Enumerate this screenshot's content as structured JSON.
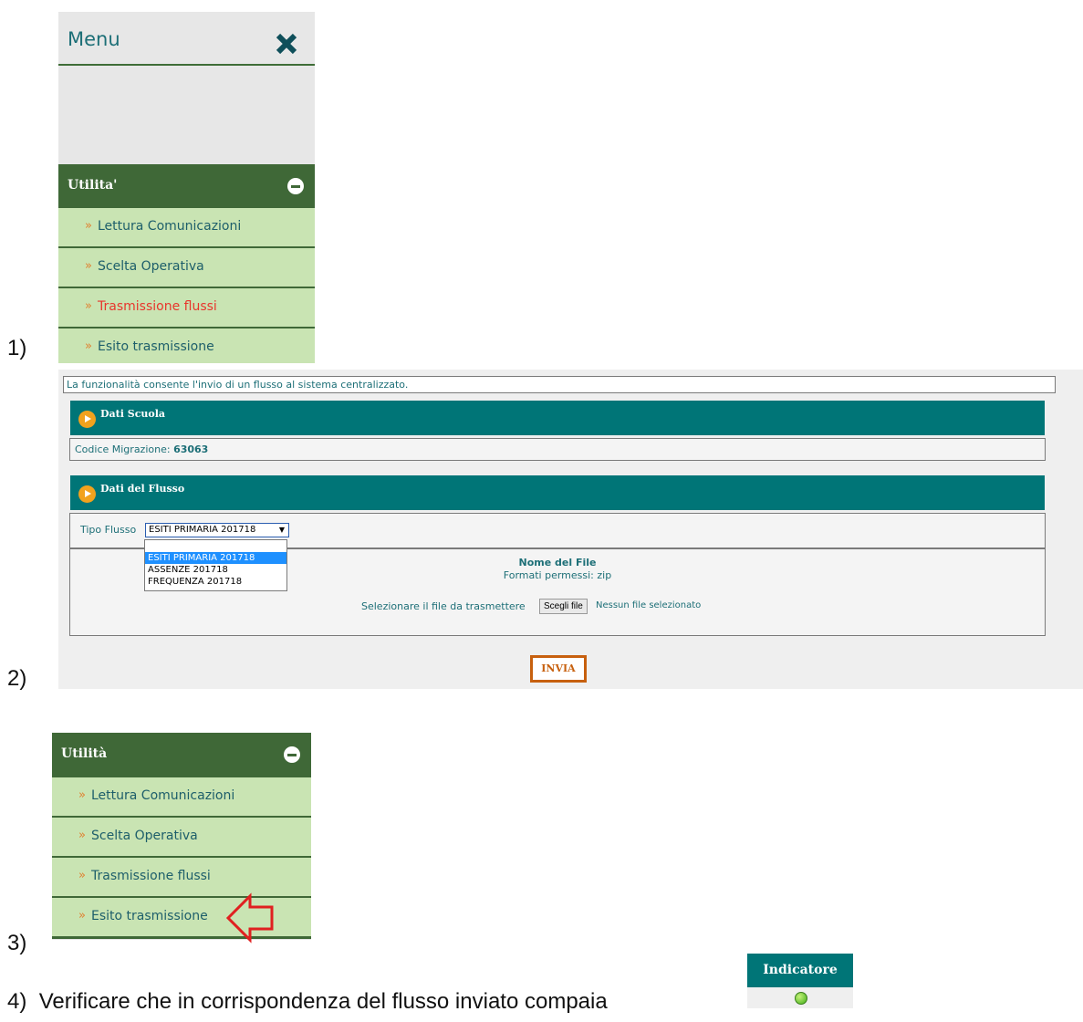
{
  "steps": {
    "s1": "1)",
    "s2": "2)",
    "s3": "3)",
    "s4": "4)"
  },
  "panel1": {
    "menu_title": "Menu",
    "section_title": "Utilita'",
    "items": [
      "Lettura Comunicazioni",
      "Scelta Operativa",
      "Trasmissione flussi",
      "Esito trasmissione"
    ],
    "active_item": "Trasmissione flussi",
    "arrow": "»"
  },
  "panel2": {
    "info": "La funzionalità consente l'invio di un flusso al sistema centralizzato.",
    "dati_scuola": "Dati Scuola",
    "codice_label": "Codice Migrazione:",
    "codice_value": "63063",
    "dati_flusso": "Dati del Flusso",
    "tipo_label": "Tipo Flusso",
    "tipo_selected": "ESITI PRIMARIA 201718",
    "options": [
      "ESITI PRIMARIA 201718",
      "ASSENZE 201718",
      "FREQUENZA 201718"
    ],
    "file_name_label": "Nome del File",
    "file_formats": "Formati permessi: zip",
    "select_file_label": "Selezionare il file da trasmettere",
    "choose_button": "Scegli file",
    "no_file": "Nessun file selezionato",
    "send_button": "INVIA"
  },
  "panel3": {
    "section_title": "Utilità",
    "items": [
      "Lettura Comunicazioni",
      "Scelta Operativa",
      "Trasmissione flussi",
      "Esito trasmissione"
    ],
    "arrow": "»"
  },
  "step4": {
    "text": "Verificare che in corrispondenza del flusso inviato compaia",
    "indicator_header": "Indicatore",
    "indicator_color": "#3fae17"
  }
}
